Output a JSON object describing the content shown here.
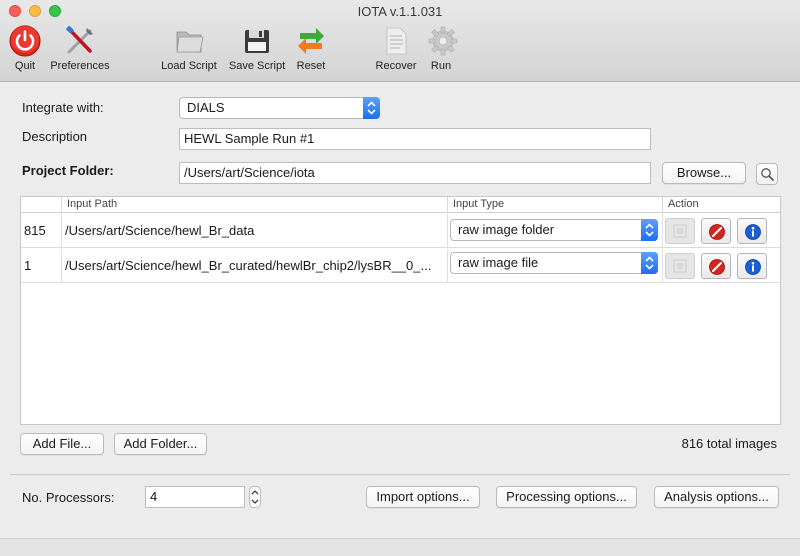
{
  "window": {
    "title": "IOTA v.1.1.031"
  },
  "toolbar": {
    "quit": "Quit",
    "preferences": "Preferences",
    "load_script": "Load Script",
    "save_script": "Save Script",
    "reset": "Reset",
    "recover": "Recover",
    "run": "Run"
  },
  "form": {
    "integrate_label": "Integrate with:",
    "integrate_value": "DIALS",
    "description_label": "Description",
    "description_value": "HEWL Sample Run #1",
    "project_folder_label": "Project Folder:",
    "project_folder_value": "/Users/art/Science/iota",
    "browse_label": "Browse..."
  },
  "table": {
    "headers": {
      "count": "",
      "input_path": "Input Path",
      "input_type": "Input Type",
      "action": "Action"
    },
    "rows": [
      {
        "count": "815",
        "path": "/Users/art/Science/hewl_Br_data",
        "type": "raw image folder"
      },
      {
        "count": "1",
        "path": "/Users/art/Science/hewl_Br_curated/hewlBr_chip2/lysBR__0_...",
        "type": "raw image file"
      }
    ]
  },
  "files": {
    "add_file": "Add File...",
    "add_folder": "Add Folder...",
    "total": "816 total images"
  },
  "bottom": {
    "processors_label": "No. Processors:",
    "processors_value": "4",
    "import_options": "Import options...",
    "processing_options": "Processing options...",
    "analysis_options": "Analysis options..."
  },
  "colors": {
    "accent": "#1d6ff0",
    "quit_red": "#e0261f",
    "window_bg": "#ececec"
  }
}
